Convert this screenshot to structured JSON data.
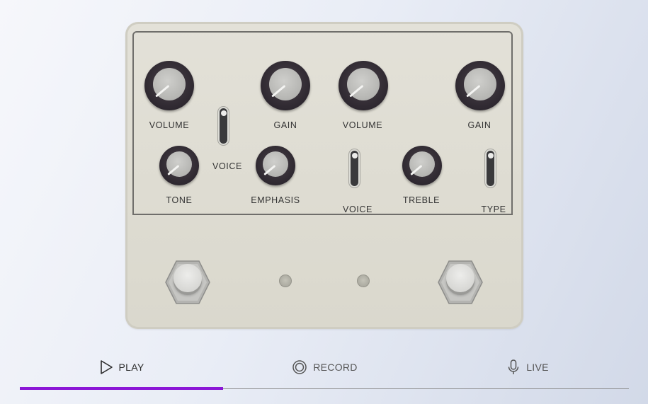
{
  "pedal": {
    "labels": {
      "volume_left": "VOLUME",
      "voice_left": "VOICE",
      "gain_left": "GAIN",
      "tone": "TONE",
      "emphasis": "EMPHASIS",
      "volume_right": "VOLUME",
      "gain_right": "GAIN",
      "voice_right": "VOICE",
      "treble": "TREBLE",
      "type": "TYPE"
    }
  },
  "tabs": {
    "play": "PLAY",
    "record": "RECORD",
    "live": "LIVE",
    "active": "play"
  },
  "colors": {
    "accent": "#8b16d6",
    "enclosure": "#dedcd2",
    "knob": "#2e2830"
  }
}
